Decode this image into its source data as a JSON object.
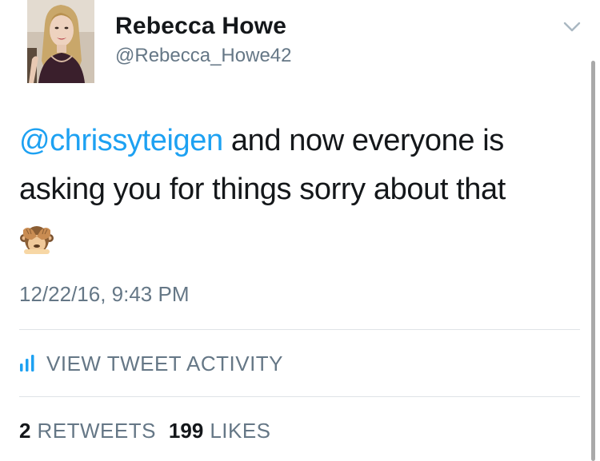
{
  "author": {
    "display_name": "Rebecca Howe",
    "handle": "@Rebecca_Howe42"
  },
  "tweet": {
    "mention": "@chrissyteigen",
    "text": " and now everyone is asking you for things sorry about that",
    "emoji": "see-no-evil-monkey",
    "timestamp": "12/22/16, 9:43 PM"
  },
  "activity": {
    "label": "VIEW TWEET ACTIVITY",
    "icon": "bar-chart-icon"
  },
  "stats": {
    "retweets_count": "2",
    "retweets_label": "RETWEETS",
    "likes_count": "199",
    "likes_label": "LIKES"
  },
  "colors": {
    "link": "#1da1f2",
    "secondary_text": "#657786",
    "primary_text": "#14171a",
    "divider": "#dfe3e7"
  }
}
